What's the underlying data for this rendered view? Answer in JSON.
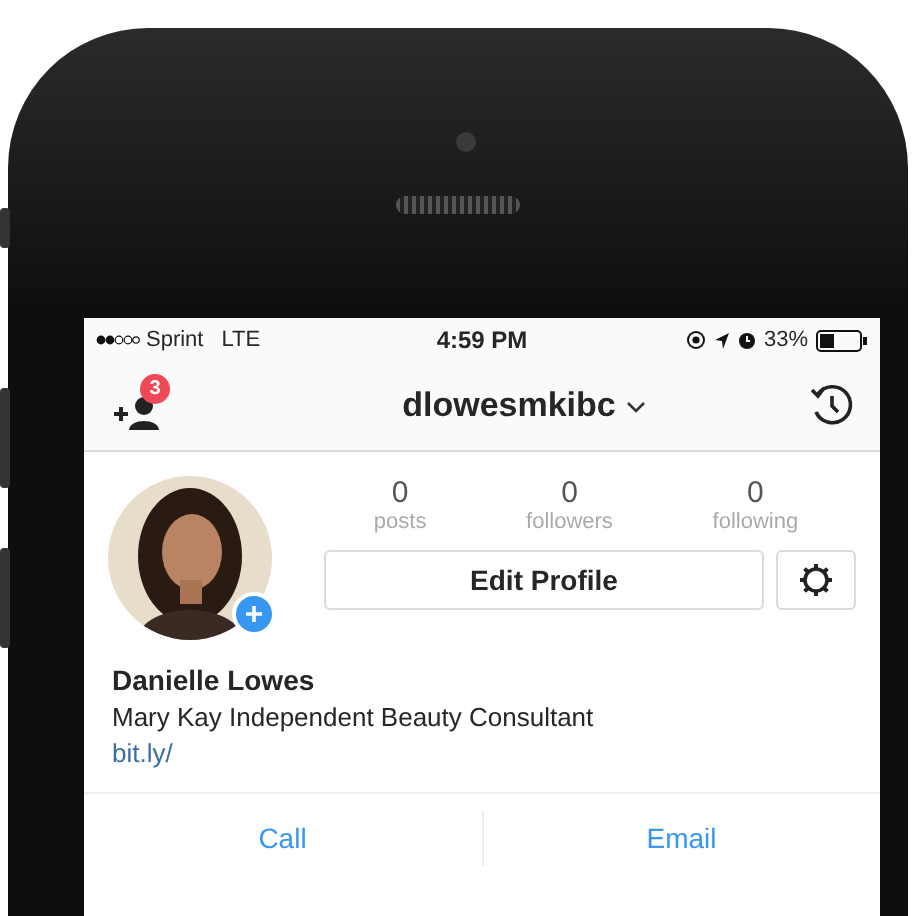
{
  "status_bar": {
    "carrier": "Sprint",
    "network": "LTE",
    "time": "4:59 PM",
    "battery": "33%"
  },
  "nav_bar": {
    "badge": "3",
    "username": "dlowesmkibc"
  },
  "stats": [
    {
      "value": "0",
      "label": "posts"
    },
    {
      "value": "0",
      "label": "followers"
    },
    {
      "value": "0",
      "label": "following"
    }
  ],
  "edit_button": "Edit Profile",
  "profile": {
    "name": "Danielle Lowes",
    "bio": "Mary Kay Independent Beauty Consultant",
    "link": "bit.ly/"
  },
  "contact_buttons": [
    "Call",
    "Email"
  ]
}
